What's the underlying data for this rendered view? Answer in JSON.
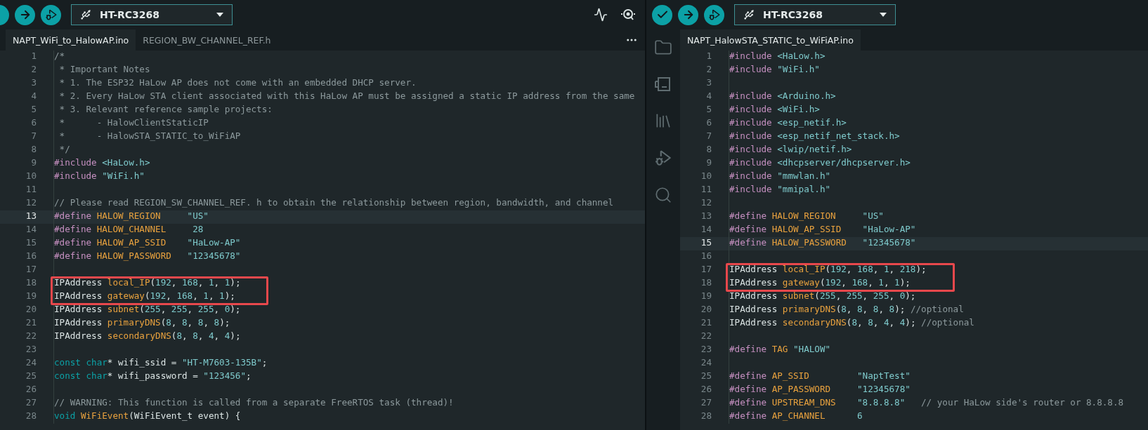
{
  "left_window": {
    "board_selector": {
      "value": "HT-RC3268"
    },
    "tabs": [
      {
        "label": "NAPT_WiFi_to_HalowAP.ino",
        "selected": true
      },
      {
        "label": "REGION_BW_CHANNEL_REF.h",
        "selected": false
      }
    ],
    "editor": {
      "lines": [
        {
          "number": "1",
          "current": false,
          "boxed": false,
          "tokens": [
            {
              "kind": "comment",
              "text": "/*"
            }
          ]
        },
        {
          "number": "2",
          "current": false,
          "boxed": false,
          "tokens": [
            {
              "kind": "comment",
              "text": " * Important Notes"
            }
          ]
        },
        {
          "number": "3",
          "current": false,
          "boxed": false,
          "tokens": [
            {
              "kind": "comment",
              "text": " * 1. The ESP32 HaLow AP does not come with an embedded DHCP server."
            }
          ]
        },
        {
          "number": "4",
          "current": false,
          "boxed": false,
          "tokens": [
            {
              "kind": "comment",
              "text": " * 2. Every HaLow STA client associated with this HaLow AP must be assigned a static IP address from the same"
            }
          ]
        },
        {
          "number": "5",
          "current": false,
          "boxed": false,
          "tokens": [
            {
              "kind": "comment",
              "text": " * 3. Relevant reference sample projects:"
            }
          ]
        },
        {
          "number": "6",
          "current": false,
          "boxed": false,
          "tokens": [
            {
              "kind": "comment",
              "text": " *      - HalowClientStaticIP"
            }
          ]
        },
        {
          "number": "7",
          "current": false,
          "boxed": false,
          "tokens": [
            {
              "kind": "comment",
              "text": " *      - HalowSTA_STATIC_to_WiFiAP"
            }
          ]
        },
        {
          "number": "8",
          "current": false,
          "boxed": false,
          "tokens": [
            {
              "kind": "comment",
              "text": " */"
            }
          ]
        },
        {
          "number": "9",
          "current": false,
          "boxed": false,
          "tokens": [
            {
              "kind": "directive",
              "text": "#include "
            },
            {
              "kind": "string",
              "text": "<HaLow.h>"
            }
          ]
        },
        {
          "number": "10",
          "current": false,
          "boxed": false,
          "tokens": [
            {
              "kind": "directive",
              "text": "#include "
            },
            {
              "kind": "string",
              "text": "\"WiFi.h\""
            }
          ]
        },
        {
          "number": "11",
          "current": false,
          "boxed": false
        },
        {
          "number": "12",
          "current": false,
          "boxed": false,
          "tokens": [
            {
              "kind": "comment",
              "text": "// Please read REGION_SW_CHANNEL_REF. h to obtain the relationship between region, bandwidth, and channel"
            }
          ]
        },
        {
          "number": "13",
          "current": true,
          "boxed": false,
          "tokens": [
            {
              "kind": "directive",
              "text": "#define "
            },
            {
              "kind": "ident",
              "text": "HALOW_REGION"
            },
            {
              "kind": "string",
              "text": "     \"US\""
            }
          ]
        },
        {
          "number": "14",
          "current": false,
          "boxed": false,
          "tokens": [
            {
              "kind": "directive",
              "text": "#define "
            },
            {
              "kind": "ident",
              "text": "HALOW_CHANNEL"
            },
            {
              "kind": "number",
              "text": "     28"
            }
          ]
        },
        {
          "number": "15",
          "current": false,
          "boxed": false,
          "tokens": [
            {
              "kind": "directive",
              "text": "#define "
            },
            {
              "kind": "ident",
              "text": "HALOW_AP_SSID"
            },
            {
              "kind": "string",
              "text": "    \"HaLow-AP\""
            }
          ]
        },
        {
          "number": "16",
          "current": false,
          "boxed": false,
          "tokens": [
            {
              "kind": "directive",
              "text": "#define "
            },
            {
              "kind": "ident",
              "text": "HALOW_PASSWORD"
            },
            {
              "kind": "string",
              "text": "   \"12345678\""
            }
          ]
        },
        {
          "number": "17",
          "current": false,
          "boxed": false
        },
        {
          "number": "18",
          "current": false,
          "boxed": true,
          "tokens": [
            {
              "kind": "plain",
              "text": "IPAddress "
            },
            {
              "kind": "ident",
              "text": "local_IP"
            },
            {
              "kind": "plain",
              "text": "("
            },
            {
              "kind": "number",
              "text": "192"
            },
            {
              "kind": "plain",
              "text": ", "
            },
            {
              "kind": "number",
              "text": "168"
            },
            {
              "kind": "plain",
              "text": ", "
            },
            {
              "kind": "number",
              "text": "1"
            },
            {
              "kind": "plain",
              "text": ", "
            },
            {
              "kind": "number",
              "text": "1"
            },
            {
              "kind": "plain",
              "text": ");"
            }
          ]
        },
        {
          "number": "19",
          "current": false,
          "boxed": true,
          "tokens": [
            {
              "kind": "plain",
              "text": "IPAddress "
            },
            {
              "kind": "ident",
              "text": "gateway"
            },
            {
              "kind": "plain",
              "text": "("
            },
            {
              "kind": "number",
              "text": "192"
            },
            {
              "kind": "plain",
              "text": ", "
            },
            {
              "kind": "number",
              "text": "168"
            },
            {
              "kind": "plain",
              "text": ", "
            },
            {
              "kind": "number",
              "text": "1"
            },
            {
              "kind": "plain",
              "text": ", "
            },
            {
              "kind": "number",
              "text": "1"
            },
            {
              "kind": "plain",
              "text": ");"
            }
          ]
        },
        {
          "number": "20",
          "current": false,
          "boxed": false,
          "tokens": [
            {
              "kind": "plain",
              "text": "IPAddress "
            },
            {
              "kind": "ident",
              "text": "subnet"
            },
            {
              "kind": "plain",
              "text": "("
            },
            {
              "kind": "number",
              "text": "255"
            },
            {
              "kind": "plain",
              "text": ", "
            },
            {
              "kind": "number",
              "text": "255"
            },
            {
              "kind": "plain",
              "text": ", "
            },
            {
              "kind": "number",
              "text": "255"
            },
            {
              "kind": "plain",
              "text": ", "
            },
            {
              "kind": "number",
              "text": "0"
            },
            {
              "kind": "plain",
              "text": ");"
            }
          ]
        },
        {
          "number": "21",
          "current": false,
          "boxed": false,
          "tokens": [
            {
              "kind": "plain",
              "text": "IPAddress "
            },
            {
              "kind": "ident",
              "text": "primaryDNS"
            },
            {
              "kind": "plain",
              "text": "("
            },
            {
              "kind": "number",
              "text": "8"
            },
            {
              "kind": "plain",
              "text": ", "
            },
            {
              "kind": "number",
              "text": "8"
            },
            {
              "kind": "plain",
              "text": ", "
            },
            {
              "kind": "number",
              "text": "8"
            },
            {
              "kind": "plain",
              "text": ", "
            },
            {
              "kind": "number",
              "text": "8"
            },
            {
              "kind": "plain",
              "text": ");"
            }
          ]
        },
        {
          "number": "22",
          "current": false,
          "boxed": false,
          "tokens": [
            {
              "kind": "plain",
              "text": "IPAddress "
            },
            {
              "kind": "ident",
              "text": "secondaryDNS"
            },
            {
              "kind": "plain",
              "text": "("
            },
            {
              "kind": "number",
              "text": "8"
            },
            {
              "kind": "plain",
              "text": ", "
            },
            {
              "kind": "number",
              "text": "8"
            },
            {
              "kind": "plain",
              "text": ", "
            },
            {
              "kind": "number",
              "text": "4"
            },
            {
              "kind": "plain",
              "text": ", "
            },
            {
              "kind": "number",
              "text": "4"
            },
            {
              "kind": "plain",
              "text": ");"
            }
          ]
        },
        {
          "number": "23",
          "current": false,
          "boxed": false
        },
        {
          "number": "24",
          "current": false,
          "boxed": false,
          "tokens": [
            {
              "kind": "type",
              "text": "const "
            },
            {
              "kind": "type",
              "text": "char"
            },
            {
              "kind": "plain",
              "text": "* wifi_ssid = "
            },
            {
              "kind": "string",
              "text": "\"HT-M7603-135B\""
            },
            {
              "kind": "plain",
              "text": ";"
            }
          ]
        },
        {
          "number": "25",
          "current": false,
          "boxed": false,
          "tokens": [
            {
              "kind": "type",
              "text": "const "
            },
            {
              "kind": "type",
              "text": "char"
            },
            {
              "kind": "plain",
              "text": "* wifi_password = "
            },
            {
              "kind": "string",
              "text": "\"123456\""
            },
            {
              "kind": "plain",
              "text": ";"
            }
          ]
        },
        {
          "number": "26",
          "current": false,
          "boxed": false
        },
        {
          "number": "27",
          "current": false,
          "boxed": false,
          "tokens": [
            {
              "kind": "comment",
              "text": "// WARNING: This function is called from a separate FreeRTOS task (thread)!"
            }
          ]
        },
        {
          "number": "28",
          "current": false,
          "boxed": false,
          "tokens": [
            {
              "kind": "type",
              "text": "void "
            },
            {
              "kind": "ident",
              "text": "WiFiEvent"
            },
            {
              "kind": "plain",
              "text": "(WiFiEvent_t event) {"
            }
          ]
        }
      ]
    }
  },
  "right_window": {
    "board_selector": {
      "value": "HT-RC3268"
    },
    "tabs": [
      {
        "label": "NAPT_HalowSTA_STATIC_to_WiFiAP.ino",
        "selected": true
      }
    ],
    "editor": {
      "lines": [
        {
          "number": "1",
          "current": false,
          "boxed": false,
          "tokens": [
            {
              "kind": "directive",
              "text": "#include "
            },
            {
              "kind": "string",
              "text": "<HaLow.h>"
            }
          ]
        },
        {
          "number": "2",
          "current": false,
          "boxed": false,
          "tokens": [
            {
              "kind": "directive",
              "text": "#include "
            },
            {
              "kind": "string",
              "text": "\"WiFi.h\""
            }
          ]
        },
        {
          "number": "3",
          "current": false,
          "boxed": false
        },
        {
          "number": "4",
          "current": false,
          "boxed": false,
          "tokens": [
            {
              "kind": "directive",
              "text": "#include "
            },
            {
              "kind": "string",
              "text": "<Arduino.h>"
            }
          ]
        },
        {
          "number": "5",
          "current": false,
          "boxed": false,
          "tokens": [
            {
              "kind": "directive",
              "text": "#include "
            },
            {
              "kind": "string",
              "text": "<WiFi.h>"
            }
          ]
        },
        {
          "number": "6",
          "current": false,
          "boxed": false,
          "tokens": [
            {
              "kind": "directive",
              "text": "#include "
            },
            {
              "kind": "string",
              "text": "<esp_netif.h>"
            }
          ]
        },
        {
          "number": "7",
          "current": false,
          "boxed": false,
          "tokens": [
            {
              "kind": "directive",
              "text": "#include "
            },
            {
              "kind": "string",
              "text": "<esp_netif_net_stack.h>"
            }
          ]
        },
        {
          "number": "8",
          "current": false,
          "boxed": false,
          "tokens": [
            {
              "kind": "directive",
              "text": "#include "
            },
            {
              "kind": "string",
              "text": "<lwip/netif.h>"
            }
          ]
        },
        {
          "number": "9",
          "current": false,
          "boxed": false,
          "tokens": [
            {
              "kind": "directive",
              "text": "#include "
            },
            {
              "kind": "string",
              "text": "<dhcpserver/dhcpserver.h>"
            }
          ]
        },
        {
          "number": "10",
          "current": false,
          "boxed": false,
          "tokens": [
            {
              "kind": "directive",
              "text": "#include "
            },
            {
              "kind": "string",
              "text": "\"mmwlan.h\""
            }
          ]
        },
        {
          "number": "11",
          "current": false,
          "boxed": false,
          "tokens": [
            {
              "kind": "directive",
              "text": "#include "
            },
            {
              "kind": "string",
              "text": "\"mmipal.h\""
            }
          ]
        },
        {
          "number": "12",
          "current": false,
          "boxed": false
        },
        {
          "number": "13",
          "current": false,
          "boxed": false,
          "tokens": [
            {
              "kind": "directive",
              "text": "#define "
            },
            {
              "kind": "ident",
              "text": "HALOW_REGION"
            },
            {
              "kind": "string",
              "text": "     \"US\""
            }
          ]
        },
        {
          "number": "14",
          "current": false,
          "boxed": false,
          "tokens": [
            {
              "kind": "directive",
              "text": "#define "
            },
            {
              "kind": "ident",
              "text": "HALOW_AP_SSID"
            },
            {
              "kind": "string",
              "text": "    \"HaLow-AP\""
            }
          ]
        },
        {
          "number": "15",
          "current": true,
          "boxed": false,
          "tokens": [
            {
              "kind": "directive",
              "text": "#define "
            },
            {
              "kind": "ident",
              "text": "HALOW_PASSWORD"
            },
            {
              "kind": "string",
              "text": "   \"12345678\""
            }
          ]
        },
        {
          "number": "16",
          "current": false,
          "boxed": false
        },
        {
          "number": "17",
          "current": false,
          "boxed": true,
          "tokens": [
            {
              "kind": "plain",
              "text": "IPAddress "
            },
            {
              "kind": "ident",
              "text": "local_IP"
            },
            {
              "kind": "plain",
              "text": "("
            },
            {
              "kind": "number",
              "text": "192"
            },
            {
              "kind": "plain",
              "text": ", "
            },
            {
              "kind": "number",
              "text": "168"
            },
            {
              "kind": "plain",
              "text": ", "
            },
            {
              "kind": "number",
              "text": "1"
            },
            {
              "kind": "plain",
              "text": ", "
            },
            {
              "kind": "number",
              "text": "218"
            },
            {
              "kind": "plain",
              "text": ");"
            }
          ]
        },
        {
          "number": "18",
          "current": false,
          "boxed": true,
          "tokens": [
            {
              "kind": "plain",
              "text": "IPAddress "
            },
            {
              "kind": "ident",
              "text": "gateway"
            },
            {
              "kind": "plain",
              "text": "("
            },
            {
              "kind": "number",
              "text": "192"
            },
            {
              "kind": "plain",
              "text": ", "
            },
            {
              "kind": "number",
              "text": "168"
            },
            {
              "kind": "plain",
              "text": ", "
            },
            {
              "kind": "number",
              "text": "1"
            },
            {
              "kind": "plain",
              "text": ", "
            },
            {
              "kind": "number",
              "text": "1"
            },
            {
              "kind": "plain",
              "text": ");"
            }
          ]
        },
        {
          "number": "19",
          "current": false,
          "boxed": false,
          "tokens": [
            {
              "kind": "plain",
              "text": "IPAddress "
            },
            {
              "kind": "ident",
              "text": "subnet"
            },
            {
              "kind": "plain",
              "text": "("
            },
            {
              "kind": "number",
              "text": "255"
            },
            {
              "kind": "plain",
              "text": ", "
            },
            {
              "kind": "number",
              "text": "255"
            },
            {
              "kind": "plain",
              "text": ", "
            },
            {
              "kind": "number",
              "text": "255"
            },
            {
              "kind": "plain",
              "text": ", "
            },
            {
              "kind": "number",
              "text": "0"
            },
            {
              "kind": "plain",
              "text": ");"
            }
          ]
        },
        {
          "number": "20",
          "current": false,
          "boxed": false,
          "tokens": [
            {
              "kind": "plain",
              "text": "IPAddress "
            },
            {
              "kind": "ident",
              "text": "primaryDNS"
            },
            {
              "kind": "plain",
              "text": "("
            },
            {
              "kind": "number",
              "text": "8"
            },
            {
              "kind": "plain",
              "text": ", "
            },
            {
              "kind": "number",
              "text": "8"
            },
            {
              "kind": "plain",
              "text": ", "
            },
            {
              "kind": "number",
              "text": "8"
            },
            {
              "kind": "plain",
              "text": ", "
            },
            {
              "kind": "number",
              "text": "8"
            },
            {
              "kind": "plain",
              "text": "); "
            },
            {
              "kind": "comment",
              "text": "//optional"
            }
          ]
        },
        {
          "number": "21",
          "current": false,
          "boxed": false,
          "tokens": [
            {
              "kind": "plain",
              "text": "IPAddress "
            },
            {
              "kind": "ident",
              "text": "secondaryDNS"
            },
            {
              "kind": "plain",
              "text": "("
            },
            {
              "kind": "number",
              "text": "8"
            },
            {
              "kind": "plain",
              "text": ", "
            },
            {
              "kind": "number",
              "text": "8"
            },
            {
              "kind": "plain",
              "text": ", "
            },
            {
              "kind": "number",
              "text": "4"
            },
            {
              "kind": "plain",
              "text": ", "
            },
            {
              "kind": "number",
              "text": "4"
            },
            {
              "kind": "plain",
              "text": "); "
            },
            {
              "kind": "comment",
              "text": "//optional"
            }
          ]
        },
        {
          "number": "22",
          "current": false,
          "boxed": false
        },
        {
          "number": "23",
          "current": false,
          "boxed": false,
          "tokens": [
            {
              "kind": "directive",
              "text": "#define "
            },
            {
              "kind": "ident",
              "text": "TAG"
            },
            {
              "kind": "string",
              "text": " \"HALOW\""
            }
          ]
        },
        {
          "number": "24",
          "current": false,
          "boxed": false
        },
        {
          "number": "25",
          "current": false,
          "boxed": false,
          "tokens": [
            {
              "kind": "directive",
              "text": "#define "
            },
            {
              "kind": "ident",
              "text": "AP_SSID"
            },
            {
              "kind": "string",
              "text": "         \"NaptTest\""
            }
          ]
        },
        {
          "number": "26",
          "current": false,
          "boxed": false,
          "tokens": [
            {
              "kind": "directive",
              "text": "#define "
            },
            {
              "kind": "ident",
              "text": "AP_PASSWORD"
            },
            {
              "kind": "string",
              "text": "     \"12345678\""
            }
          ]
        },
        {
          "number": "27",
          "current": false,
          "boxed": false,
          "tokens": [
            {
              "kind": "directive",
              "text": "#define "
            },
            {
              "kind": "ident",
              "text": "UPSTREAM_DNS"
            },
            {
              "kind": "string",
              "text": "    \"8.8.8.8\""
            },
            {
              "kind": "comment",
              "text": "   // your HaLow side's router or 8.8.8.8"
            }
          ]
        },
        {
          "number": "28",
          "current": false,
          "boxed": false,
          "tokens": [
            {
              "kind": "directive",
              "text": "#define "
            },
            {
              "kind": "ident",
              "text": "AP_CHANNEL"
            },
            {
              "kind": "number",
              "text": "      6"
            }
          ]
        }
      ]
    }
  }
}
